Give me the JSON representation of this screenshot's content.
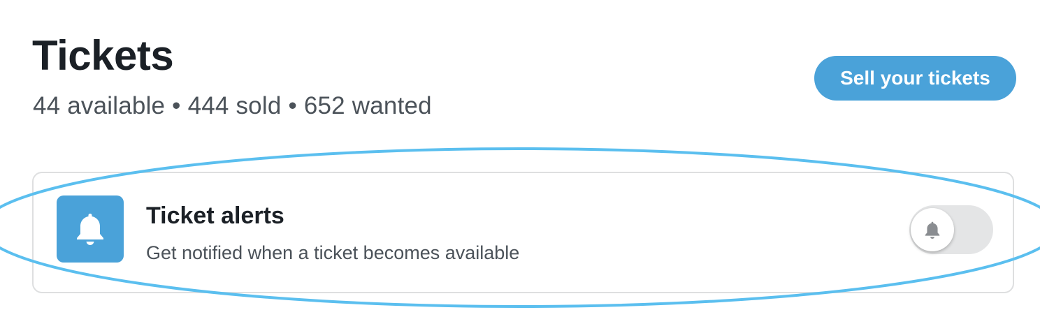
{
  "header": {
    "title": "Tickets",
    "stats": {
      "available": "44 available",
      "sold": "444 sold",
      "wanted": "652 wanted",
      "separator": "•"
    },
    "sell_button_label": "Sell your tickets"
  },
  "alerts": {
    "title": "Ticket alerts",
    "description": "Get notified when a ticket becomes available",
    "toggle_on": false,
    "icon": "bell-icon"
  },
  "colors": {
    "accent": "#4aa2d9",
    "annotation": "#5bbfef",
    "text_primary": "#1b2026",
    "text_secondary": "#4b5259",
    "toggle_track": "#e4e5e6"
  }
}
